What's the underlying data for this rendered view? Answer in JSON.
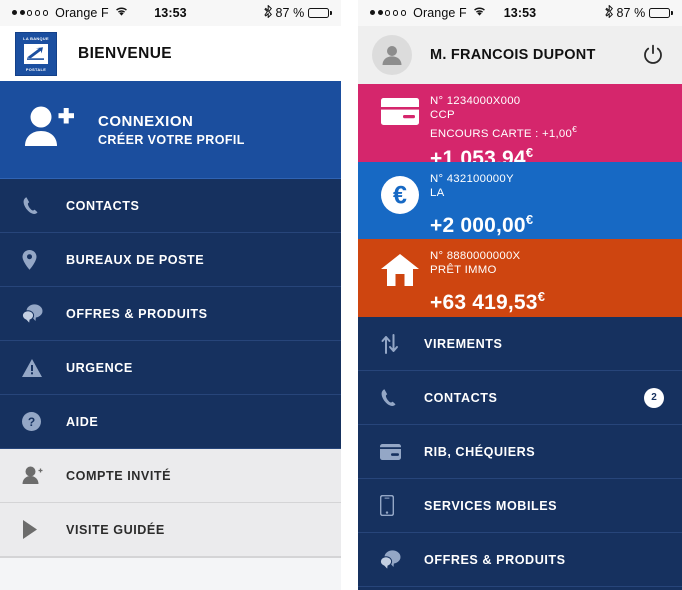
{
  "statusbar": {
    "carrier": "Orange F",
    "signal_dots": [
      "full",
      "full",
      "empty",
      "empty",
      "empty"
    ],
    "wifi_icon": "wifi-icon",
    "time": "13:53",
    "bluetooth_icon": "bluetooth-icon",
    "battery_text": "87 %",
    "battery_percent": 87
  },
  "left_screen": {
    "logo": {
      "top_text": "LA BANQUE",
      "bottom_text": "POSTALE",
      "icon": "postal-bird-icon"
    },
    "header_title": "BIENVENUE",
    "connexion": {
      "icon": "user-add-icon",
      "title": "CONNEXION",
      "subtitle": "CRÉER VOTRE PROFIL"
    },
    "menu": [
      {
        "label": "CONTACTS",
        "icon": "phone-icon",
        "style": "navy"
      },
      {
        "label": "BUREAUX DE POSTE",
        "icon": "map-pin-icon",
        "style": "navy"
      },
      {
        "label": "OFFRES & PRODUITS",
        "icon": "chat-bubbles-icon",
        "style": "navy"
      },
      {
        "label": "URGENCE",
        "icon": "warning-triangle-icon",
        "style": "navy"
      },
      {
        "label": "AIDE",
        "icon": "question-circle-icon",
        "style": "navy"
      },
      {
        "label": "COMPTE INVITÉ",
        "icon": "user-guest-icon",
        "style": "light"
      },
      {
        "label": "VISITE GUIDÉE",
        "icon": "play-triangle-icon",
        "style": "light"
      }
    ]
  },
  "right_screen": {
    "header": {
      "avatar_icon": "avatar-icon",
      "user_name": "M. FRANCOIS DUPONT",
      "power_icon": "power-icon"
    },
    "accounts": [
      {
        "icon": "credit-card-icon",
        "number": "N° 1234000X000",
        "type": "CCP",
        "extra": "ENCOURS CARTE : +1,00",
        "extra_currency": "€",
        "amount": "+1 053,94",
        "currency": "€",
        "color": "#d5266c"
      },
      {
        "icon": "euro-circle-icon",
        "number": "N° 432100000Y",
        "type": "LA",
        "extra": "",
        "extra_currency": "",
        "amount": "+2 000,00",
        "currency": "€",
        "color": "#1769c4"
      },
      {
        "icon": "house-icon",
        "number": "N° 8880000000X",
        "type": "PRÊT IMMO",
        "extra": "",
        "extra_currency": "",
        "amount": "+63 419,53",
        "currency": "€",
        "color": "#ce4510"
      }
    ],
    "menu": [
      {
        "label": "VIREMENTS",
        "icon": "transfer-arrows-icon",
        "badge": ""
      },
      {
        "label": "CONTACTS",
        "icon": "phone-icon",
        "badge": "2"
      },
      {
        "label": "RIB, CHÉQUIERS",
        "icon": "wallet-icon",
        "badge": ""
      },
      {
        "label": "SERVICES MOBILES",
        "icon": "mobile-phone-icon",
        "badge": ""
      },
      {
        "label": "OFFRES & PRODUITS",
        "icon": "chat-bubbles-icon",
        "badge": ""
      }
    ]
  }
}
